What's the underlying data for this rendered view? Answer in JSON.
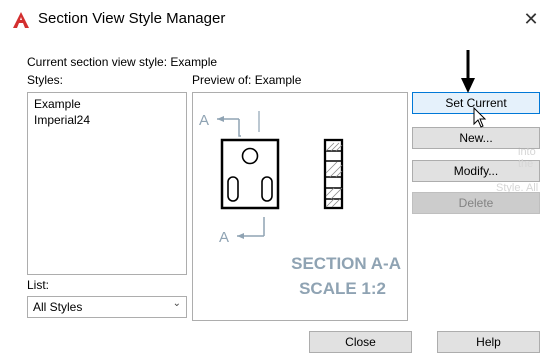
{
  "window": {
    "title": "Section View Style Manager",
    "close_symbol": "✕"
  },
  "current_style_label": "Current section view style: Example",
  "styles": {
    "label": "Styles:",
    "items": [
      "Example",
      "Imperial24"
    ]
  },
  "list": {
    "label": "List:",
    "selected": "All Styles"
  },
  "preview": {
    "label": "Preview of: Example",
    "arrow_label_top": "A",
    "arrow_label_bottom": "A",
    "section_line1": "SECTION A-A",
    "section_line2": "SCALE 1:2"
  },
  "buttons": {
    "set_current": "Set Current",
    "new": "New...",
    "modify": "Modify...",
    "delete": "Delete",
    "close": "Close",
    "help": "Help"
  },
  "ghost_text": {
    "line1": "into the",
    "line2": "Style. All",
    "line3": "style"
  },
  "colors": {
    "accent": "#0078d7",
    "preview_blue": "#8fa3b3",
    "logo_red": "#d32f2f"
  }
}
